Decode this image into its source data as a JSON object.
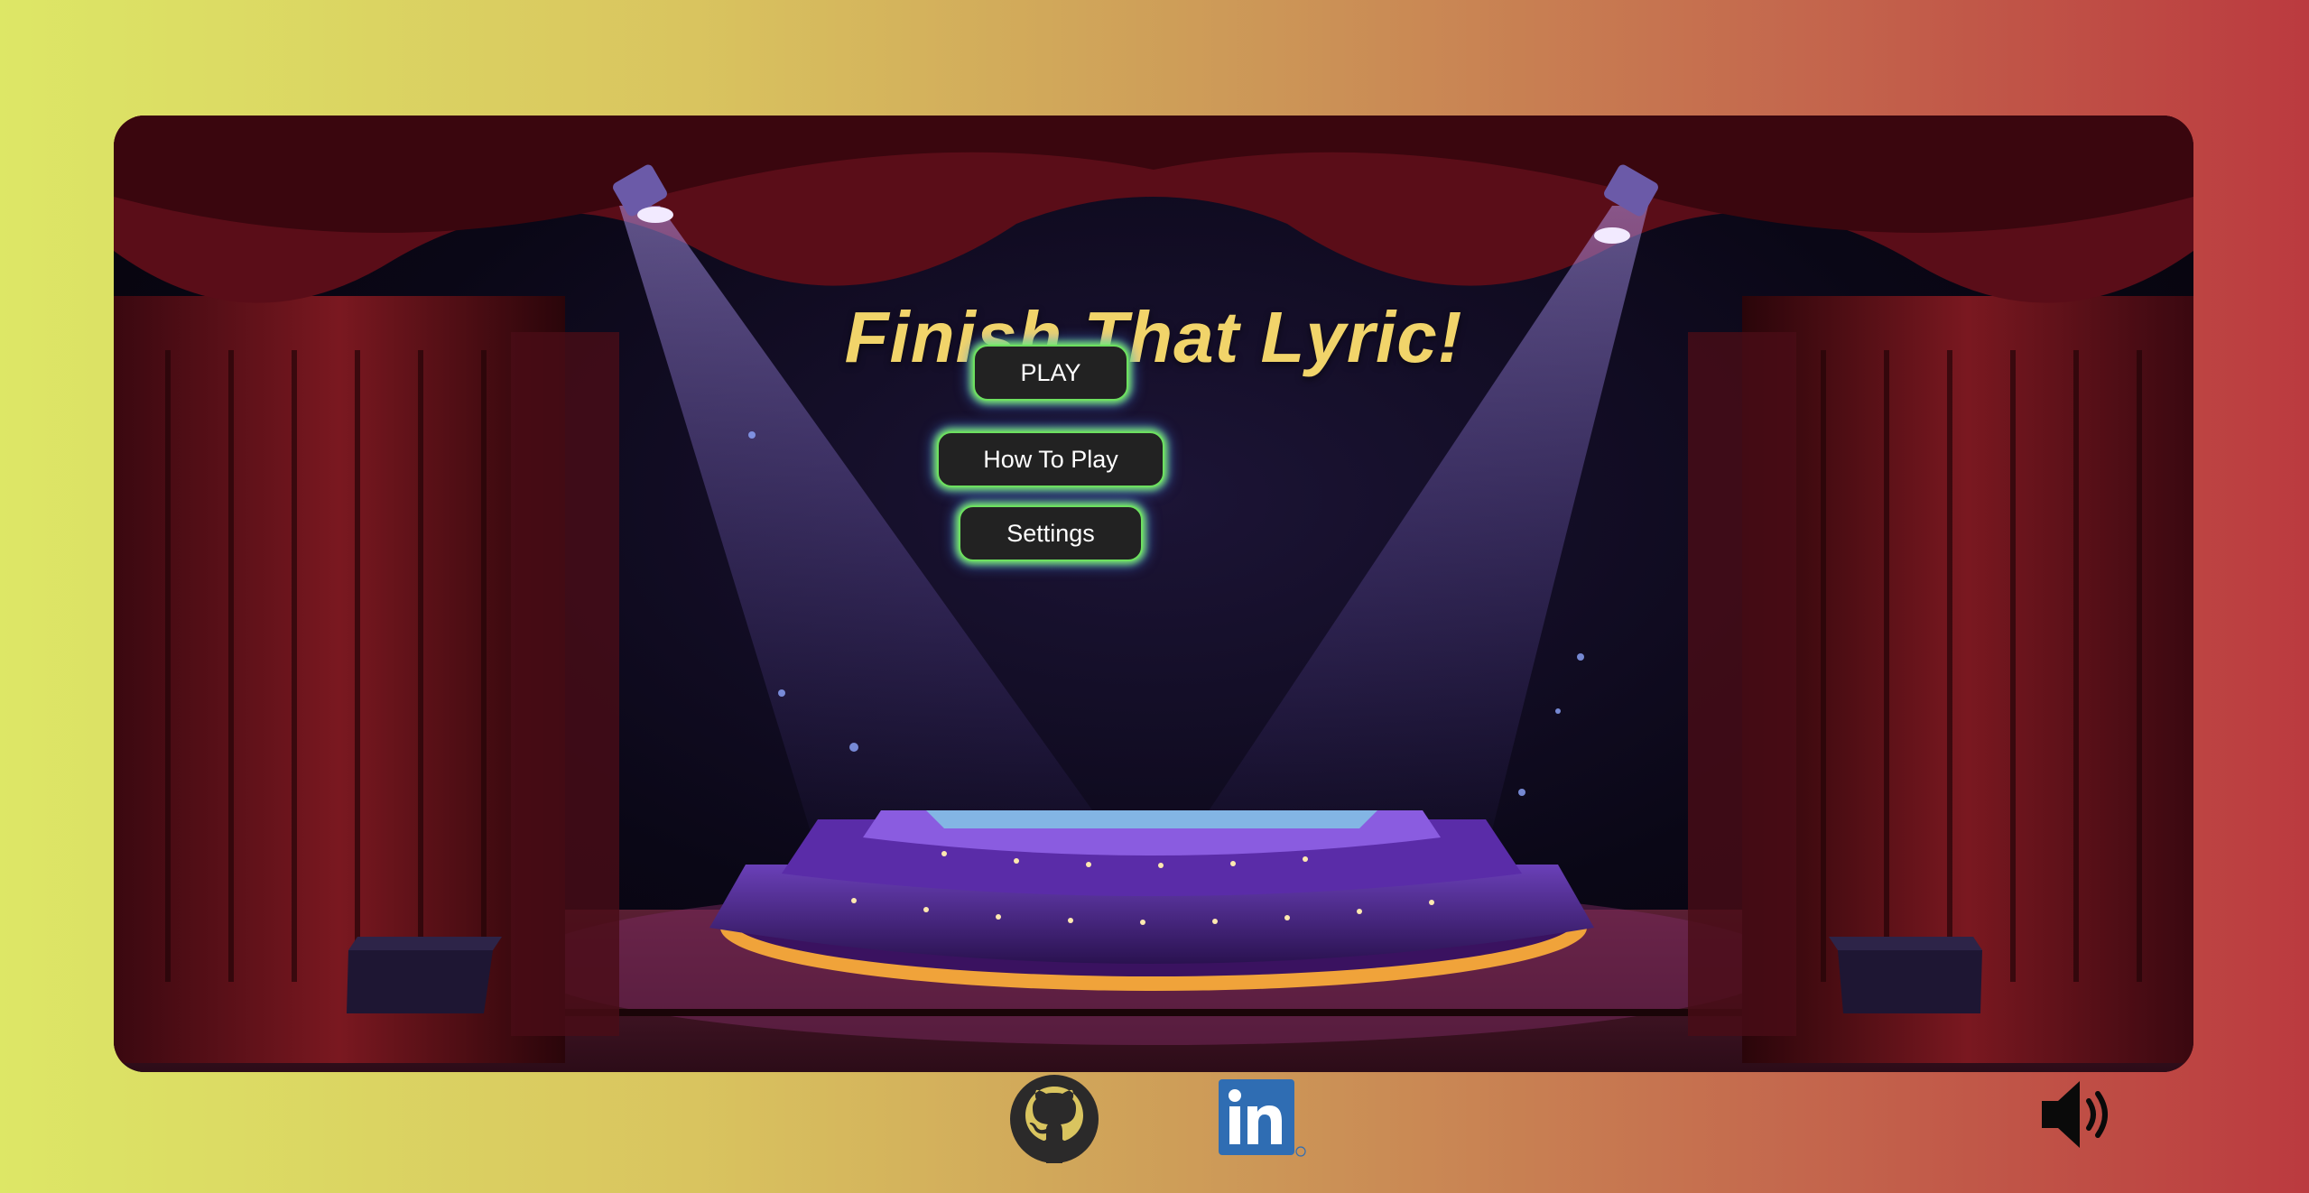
{
  "game": {
    "title": "Finish That Lyric!"
  },
  "menu": {
    "play_label": "PLAY",
    "how_to_play_label": "How To Play",
    "settings_label": "Settings"
  },
  "footer": {
    "github_icon": "github-icon",
    "linkedin_icon": "linkedin-icon",
    "sound_icon": "speaker-icon"
  },
  "colors": {
    "title": "#f1d46a",
    "button_bg": "#222222",
    "button_glow": "#7cf06a",
    "linkedin_blue": "#2f6db3"
  }
}
